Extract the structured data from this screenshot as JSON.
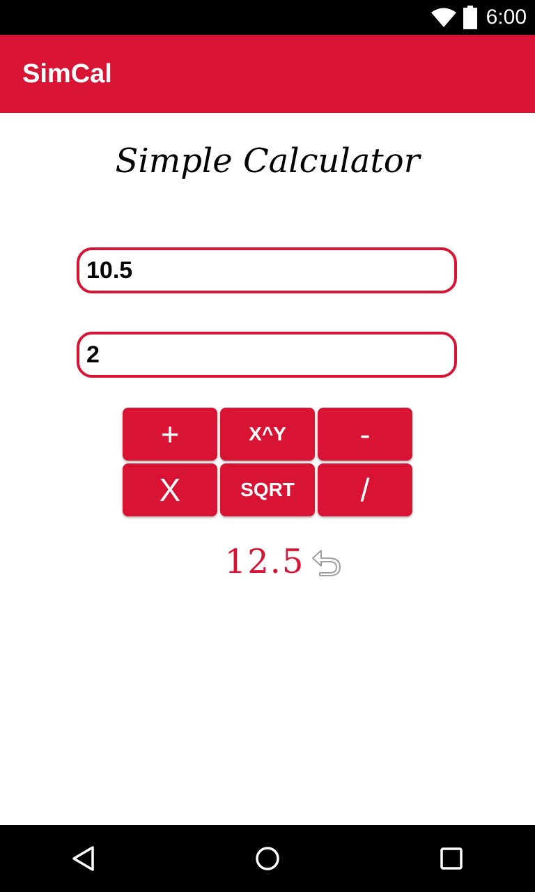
{
  "status_bar": {
    "time": "6:00",
    "icons": [
      "wifi-icon",
      "battery-icon"
    ]
  },
  "app_bar": {
    "title": "SimCal"
  },
  "heading": "Simple Calculator",
  "inputs": {
    "first_value": "10.5",
    "second_value": "2"
  },
  "buttons": {
    "add": "+",
    "power": "X^Y",
    "subtract": "-",
    "multiply": "X",
    "sqrt": "SQRT",
    "divide": "/"
  },
  "result": {
    "value": "12.5",
    "icon": "undo-icon"
  },
  "nav_bar": {
    "icons": [
      "back-icon",
      "home-icon",
      "recent-apps-icon"
    ]
  },
  "colors": {
    "accent": "#d81334",
    "status_bar": "#000000",
    "background": "#ffffff"
  }
}
